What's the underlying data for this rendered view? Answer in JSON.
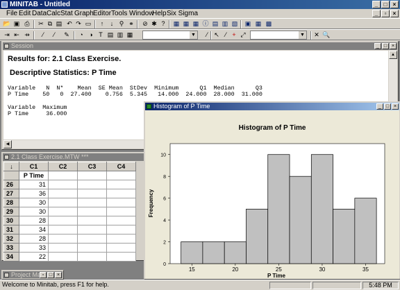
{
  "app": {
    "title": "MINITAB - Untitled"
  },
  "menus": [
    "File",
    "Edit",
    "Data",
    "Calc",
    "Stat",
    "Graph",
    "Editor",
    "Tools",
    "Window",
    "Help",
    "Six Sigma"
  ],
  "session": {
    "title": "Session",
    "results_header": "Results for: 2.1 Class Exercise.",
    "section_title": "Descriptive Statistics: P Time",
    "row1_header": "Variable   N  N*    Mean  SE Mean  StDev  Minimum      Q1  Median      Q3",
    "row1_values": "P Time    50   0  27.400    0.756  5.345   14.000  24.000  28.000  31.000",
    "row2_header": "Variable  Maximum",
    "row2_values": "P Time     36.000"
  },
  "worksheet": {
    "title": "2.1 Class Exercise.MTW ***",
    "corner": "↓",
    "columns": [
      "C1",
      "C2",
      "C3",
      "C4"
    ],
    "col1_name": "P Time",
    "rows": [
      {
        "n": "26",
        "v": "31"
      },
      {
        "n": "27",
        "v": "36"
      },
      {
        "n": "28",
        "v": "30"
      },
      {
        "n": "29",
        "v": "30"
      },
      {
        "n": "30",
        "v": "28"
      },
      {
        "n": "31",
        "v": "34"
      },
      {
        "n": "32",
        "v": "28"
      },
      {
        "n": "33",
        "v": "33"
      },
      {
        "n": "34",
        "v": "22"
      }
    ]
  },
  "project_manager": {
    "title": "Project Ma..."
  },
  "graph_window": {
    "title": "Histogram of P Time",
    "chart_data": {
      "type": "bar",
      "title": "Histogram of P Time",
      "xlabel": "P Time",
      "ylabel": "Frequency",
      "bins": [
        {
          "start": 13.75,
          "end": 16.25,
          "count": 2
        },
        {
          "start": 16.25,
          "end": 18.75,
          "count": 2
        },
        {
          "start": 18.75,
          "end": 21.25,
          "count": 2
        },
        {
          "start": 21.25,
          "end": 23.75,
          "count": 5
        },
        {
          "start": 23.75,
          "end": 26.25,
          "count": 10
        },
        {
          "start": 26.25,
          "end": 28.75,
          "count": 8
        },
        {
          "start": 28.75,
          "end": 31.25,
          "count": 10
        },
        {
          "start": 31.25,
          "end": 33.75,
          "count": 5
        },
        {
          "start": 33.75,
          "end": 36.25,
          "count": 6
        }
      ],
      "xlim": [
        12.5,
        37.2
      ],
      "ylim": [
        0,
        11
      ],
      "xticks": [
        "15",
        "20",
        "25",
        "30",
        "35"
      ],
      "yticks": [
        "0",
        "2",
        "4",
        "6",
        "8",
        "10"
      ],
      "bar_color": "#c0c0c0",
      "plot_bg": "#ffffff",
      "outer_bg": "#ece9d8"
    }
  },
  "status": {
    "message": "Welcome to Minitab, press F1 for help.",
    "time": "5:48 PM"
  }
}
